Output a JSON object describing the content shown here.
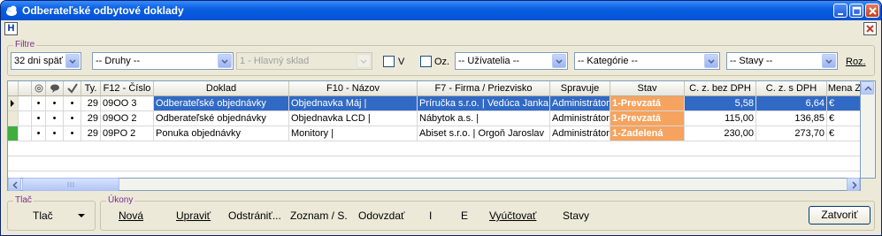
{
  "window": {
    "title": "Odberateľské odbytové doklady",
    "menu_h": "H"
  },
  "filters": {
    "group_label": "Filtre",
    "period": "32 dni späť",
    "types": "-- Druhy --",
    "warehouse": "1 - Hlavný sklad",
    "v_label": "V",
    "oz_label": "Oz.",
    "users": "-- Užívatelia --",
    "categories": "-- Kategórie --",
    "states": "-- Stavy --",
    "roz_label": "Roz."
  },
  "grid": {
    "columns": [
      "Ty.",
      "F12 - Číslo",
      "Doklad",
      "F10 - Názov",
      "F7 - Firma / Priezvisko",
      "Spravuje",
      "Stav",
      "C. z. bez DPH",
      "C. z. s DPH",
      "Mena Z"
    ],
    "rows": [
      {
        "type": "29",
        "number": "09OO 3",
        "document": "Odberateľské objednávky",
        "name": "Objednavka Máj |",
        "company": "Príručka s.r.o. | Vedúca Janka",
        "manager": "Administrátor",
        "status": "1-Prevzatá",
        "price_net": "5,58",
        "price_gross": "6,64",
        "currency": "€",
        "selected": true,
        "marker_color": ""
      },
      {
        "type": "29",
        "number": "09OO 2",
        "document": "Odberateľské objednávky",
        "name": "Objednavka LCD |",
        "company": "Nábytok a.s. |",
        "manager": "Administrátor",
        "status": "1-Prevzatá",
        "price_net": "115,00",
        "price_gross": "136,85",
        "currency": "€",
        "selected": false,
        "marker_color": ""
      },
      {
        "type": "29",
        "number": "09PO 2",
        "document": "Ponuka objednávky",
        "name": "Monitory |",
        "company": "Abiset s.r.o. | Orgoň Jaroslav",
        "manager": "Administrátor",
        "status": "1-Zadelená",
        "price_net": "230,00",
        "price_gross": "273,70",
        "currency": "€",
        "selected": false,
        "marker_color": "#3fae3f"
      }
    ]
  },
  "print_group": {
    "label": "Tlač",
    "value": "Tlač"
  },
  "actions_group": {
    "label": "Úkony",
    "new": "Nová",
    "edit": "Upraviť",
    "delete": "Odstrániť...",
    "list": "Zoznam / S.",
    "deliver": "Odovzdať",
    "i": "I",
    "e": "E",
    "bill": "Vyúčtovať",
    "states": "Stavy"
  },
  "close_label": "Zatvoriť",
  "colors": {
    "titlebar": "#0552d6",
    "selection": "#316ac5",
    "status_orange": "#f5a35e",
    "group_label": "#7b2c8a"
  }
}
